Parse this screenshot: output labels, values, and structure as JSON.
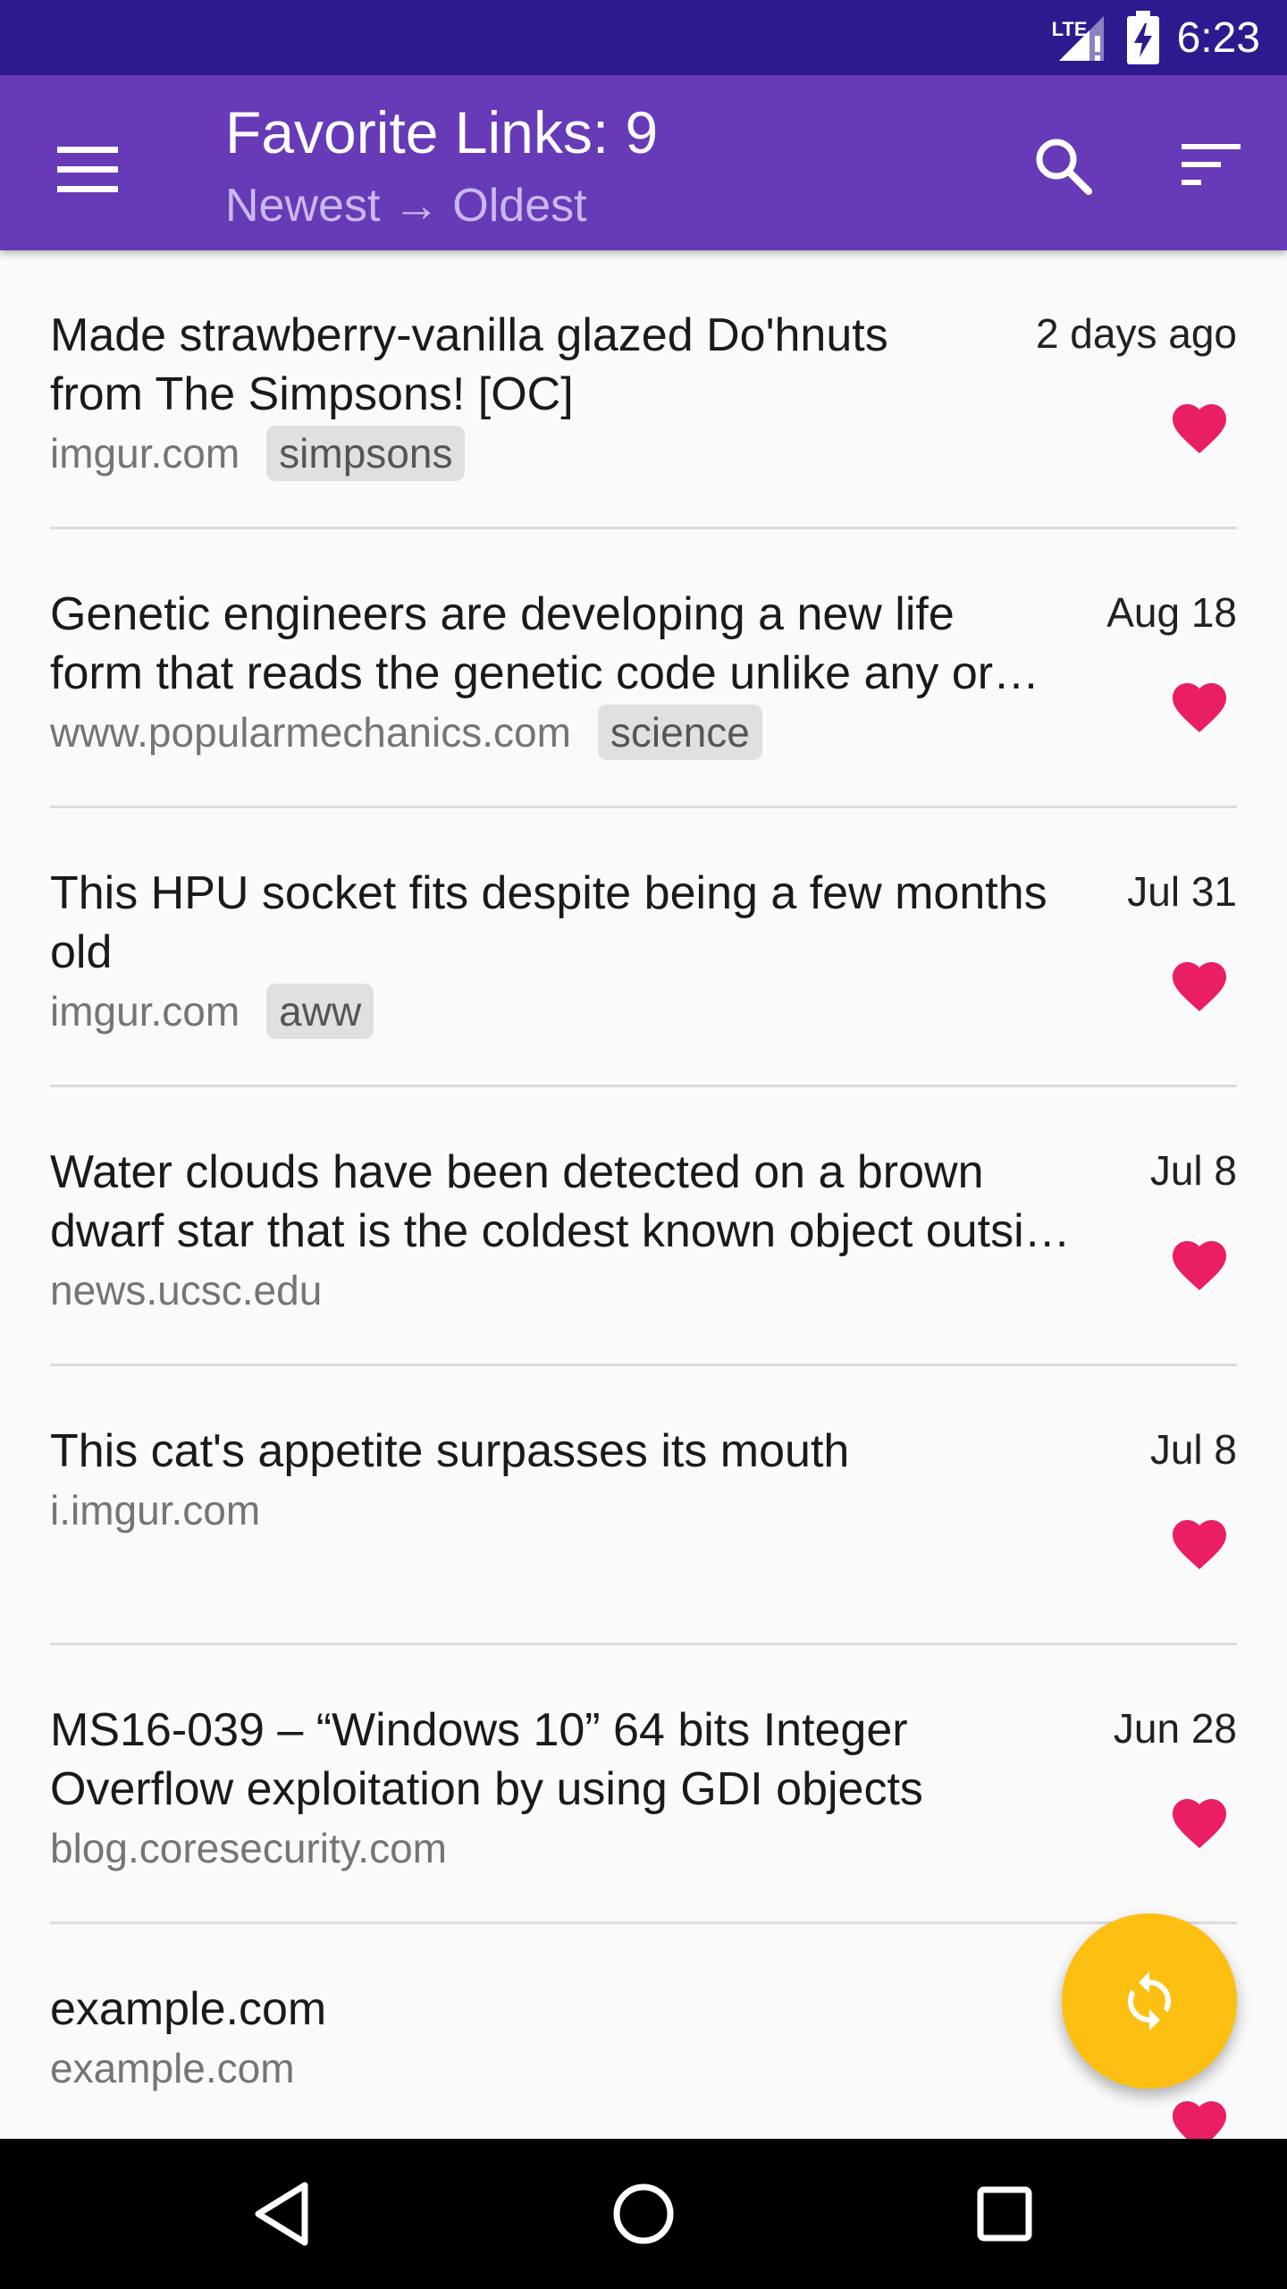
{
  "status_bar": {
    "network": "LTE",
    "time": "6:23"
  },
  "app_bar": {
    "title": "Favorite Links: 9",
    "subtitle": "Newest → Oldest",
    "menu_icon": "hamburger-menu-icon",
    "search_icon": "search-icon",
    "sort_icon": "sort-icon"
  },
  "links": [
    {
      "title_line1": "Made strawberry-vanilla glazed Do'hnuts",
      "title_line2": "from The Simpsons! [OC]",
      "domain": "imgur.com",
      "tag": "simpsons",
      "date": "2 days ago"
    },
    {
      "title_line1": "Genetic engineers are developing a new life",
      "title_line2": "form that reads the genetic code unlike any or…",
      "domain": "www.popularmechanics.com",
      "tag": "science",
      "date": "Aug 18"
    },
    {
      "title_line1": "This HPU socket fits despite being a few months",
      "title_line2": "old",
      "domain": "imgur.com",
      "tag": "aww",
      "date": "Jul 31"
    },
    {
      "title_line1": "Water clouds have been detected on a brown",
      "title_line2": "dwarf star that is the coldest known object outsi…",
      "domain": "news.ucsc.edu",
      "tag": "",
      "date": "Jul 8"
    },
    {
      "title_line1": "This cat's appetite surpasses its mouth",
      "title_line2": "",
      "domain": "i.imgur.com",
      "tag": "",
      "date": "Jul 8"
    },
    {
      "title_line1": "MS16-039 – “Windows 10” 64 bits Integer",
      "title_line2": "Overflow exploitation by using GDI objects",
      "domain": "blog.coresecurity.com",
      "tag": "",
      "date": "Jun 28"
    },
    {
      "title_line1": "example.com",
      "title_line2": "",
      "domain": "example.com",
      "tag": "",
      "date": ""
    }
  ],
  "fab": {
    "icon": "refresh-icon"
  },
  "nav_bar": {
    "back_icon": "back-icon",
    "home_icon": "home-icon",
    "recents_icon": "recents-icon"
  },
  "colors": {
    "status_bar": "#2e1a8f",
    "app_bar": "#673ab7",
    "subtitle": "#c9b8ee",
    "heart": "#e91e63",
    "fab": "#fdbf12",
    "tag_bg": "#e0e0e0"
  }
}
